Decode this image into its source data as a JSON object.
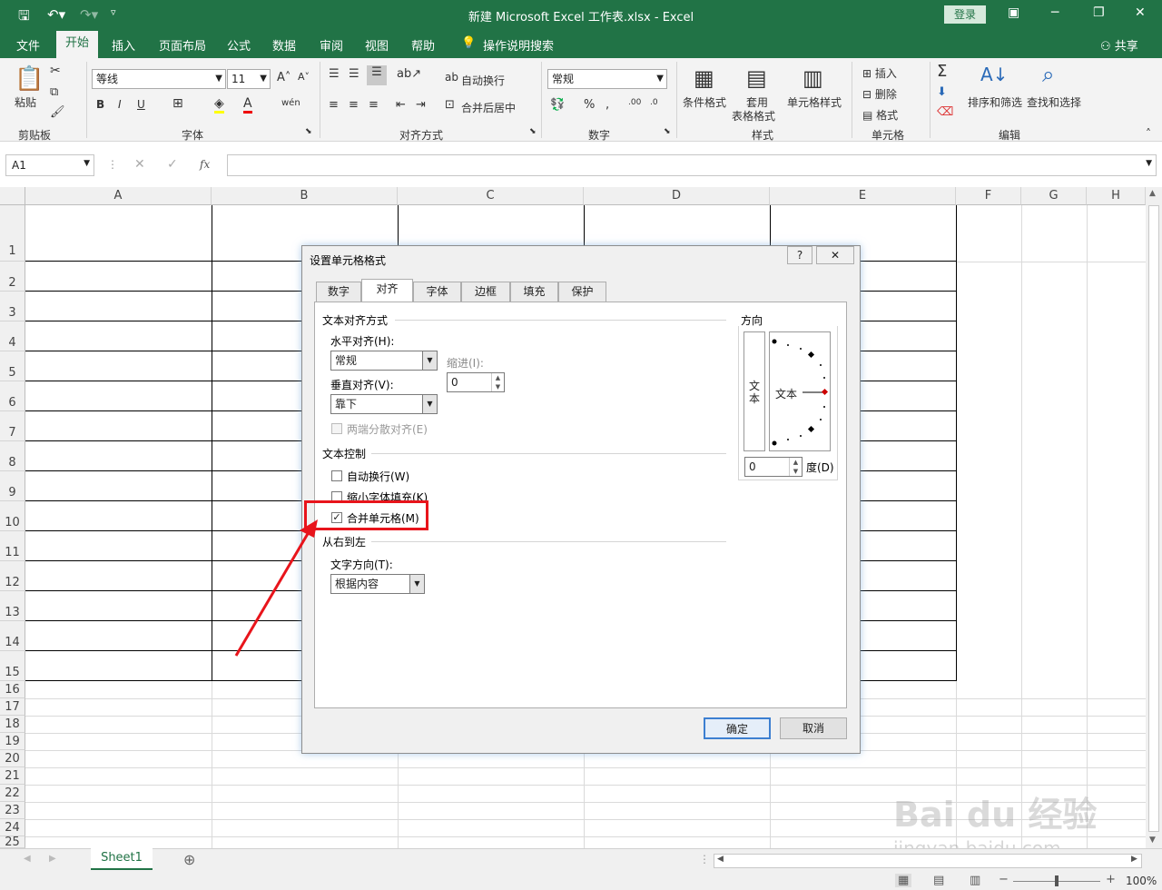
{
  "title_bar": {
    "title": "新建 Microsoft Excel 工作表.xlsx  -  Excel",
    "login": "登录"
  },
  "menu": {
    "items": [
      "文件",
      "开始",
      "插入",
      "页面布局",
      "公式",
      "数据",
      "审阅",
      "视图",
      "帮助"
    ],
    "search": "操作说明搜索",
    "share": "共享"
  },
  "ribbon": {
    "paste": "粘贴",
    "clipboard": "剪贴板",
    "font_name": "等线",
    "font_size": "11",
    "font_group": "字体",
    "wrap": "自动换行",
    "merge_center": "合并后居中",
    "align_group": "对齐方式",
    "number_format": "常规",
    "number_group": "数字",
    "cond_format": "条件格式",
    "table_format_1": "套用",
    "table_format_2": "表格格式",
    "cell_style": "单元格样式",
    "style_group": "样式",
    "insert": "插入",
    "delete": "删除",
    "format": "格式",
    "cells_group": "单元格",
    "sort_filter": "排序和筛选",
    "find_select": "查找和选择",
    "edit_group": "编辑"
  },
  "formula_bar": {
    "name_box": "A1",
    "fx": "fx"
  },
  "columns": [
    "A",
    "B",
    "C",
    "D",
    "E",
    "F",
    "G",
    "H"
  ],
  "rows": [
    "1",
    "2",
    "3",
    "4",
    "5",
    "6",
    "7",
    "8",
    "9",
    "10",
    "11",
    "12",
    "13",
    "14",
    "15",
    "16",
    "17",
    "18",
    "19",
    "20",
    "21",
    "22",
    "23",
    "24",
    "25"
  ],
  "sheet": {
    "tab": "Sheet1",
    "zoom": "100%"
  },
  "dialog": {
    "title": "设置单元格格式",
    "tabs": [
      "数字",
      "对齐",
      "字体",
      "边框",
      "填充",
      "保护"
    ],
    "text_align_section": "文本对齐方式",
    "h_align_label": "水平对齐(H):",
    "h_align_value": "常规",
    "indent_label": "缩进(I):",
    "indent_value": "0",
    "v_align_label": "垂直对齐(V):",
    "v_align_value": "靠下",
    "justify_distributed": "两端分散对齐(E)",
    "text_control_section": "文本控制",
    "wrap_text": "自动换行(W)",
    "shrink_to_fit": "缩小字体填充(K)",
    "merge_cells": "合并单元格(M)",
    "rtl_section": "从右到左",
    "text_direction_label": "文字方向(T):",
    "text_direction_value": "根据内容",
    "orientation_section": "方向",
    "orientation_vertical_text": "文本",
    "orientation_text": "文本",
    "degrees_value": "0",
    "degrees_label": "度(D)",
    "ok": "确定",
    "cancel": "取消",
    "help": "?",
    "close": "✕"
  },
  "watermark": {
    "brand": "Bai du 经验",
    "url": "jingyan.baidu.com"
  },
  "colors": {
    "excel_green": "#217346",
    "highlight_red": "#e8141b"
  }
}
